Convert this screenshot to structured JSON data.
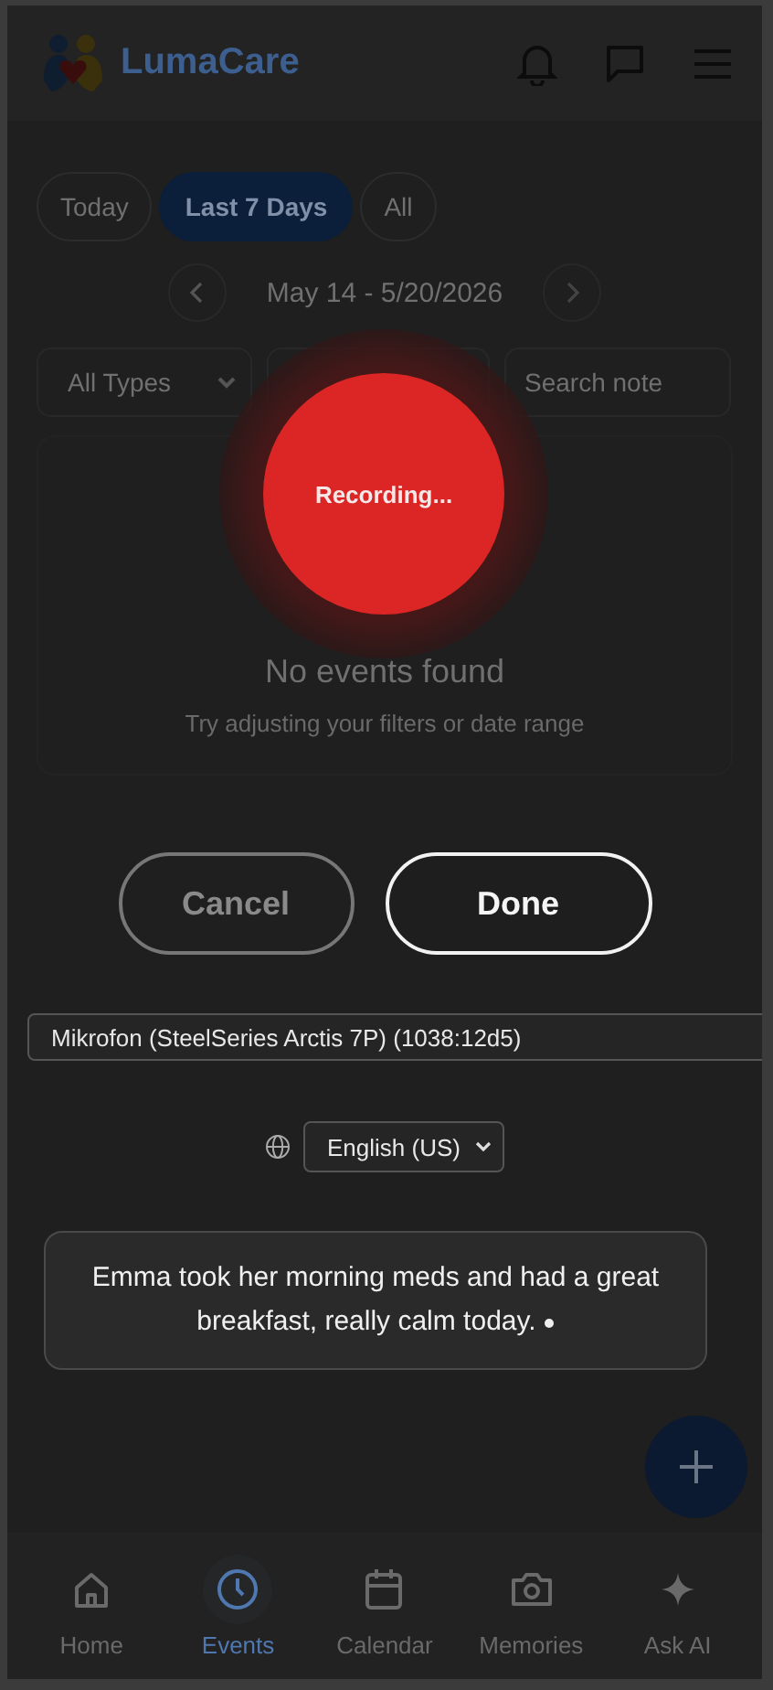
{
  "header": {
    "app_name": "LumaCare"
  },
  "range_tabs": [
    {
      "label": "Today",
      "selected": false
    },
    {
      "label": "Last 7 Days",
      "selected": true
    },
    {
      "label": "All",
      "selected": false
    }
  ],
  "date_range": {
    "label": "May 14 - 5/20/2026"
  },
  "filters": {
    "type": "All Types",
    "search_placeholder": "Search note"
  },
  "empty_state": {
    "title": "No events found",
    "hint": "Try adjusting your filters or date range"
  },
  "recording": {
    "label": "Recording..."
  },
  "actions": [
    {
      "label": "Cancel",
      "kind": "secondary"
    },
    {
      "label": "Done",
      "kind": "primary"
    }
  ],
  "microphone": {
    "value": "Mikrofon (SteelSeries Arctis 7P) (1038:12d5)"
  },
  "language": {
    "value": "English (US)"
  },
  "transcript": {
    "text": "Emma took her morning meds and had a great breakfast, really calm today.",
    "listening": true
  },
  "nav": [
    {
      "label": "Home",
      "kind": "home",
      "selected": false
    },
    {
      "label": "Events",
      "kind": "clock",
      "selected": true
    },
    {
      "label": "Calendar",
      "kind": "calendar",
      "selected": false
    },
    {
      "label": "Memories",
      "kind": "camera",
      "selected": false
    },
    {
      "label": "Ask AI",
      "kind": "sparkle",
      "selected": false
    }
  ]
}
